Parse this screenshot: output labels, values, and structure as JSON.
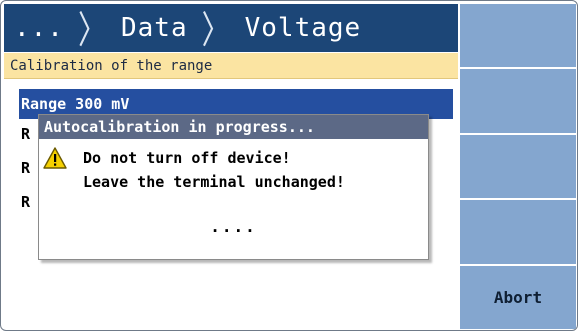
{
  "header": {
    "crumbs": [
      "...",
      "Data",
      "Voltage"
    ],
    "separator": "〉"
  },
  "subtitle": "Calibration of the range",
  "list": {
    "selected_label": "Range 300 mV",
    "stub_label": "R"
  },
  "dialog": {
    "title": "Autocalibration in progress...",
    "line1": "Do not turn off device!",
    "line2": "Leave the terminal unchanged!",
    "progress": "....",
    "icon": "warning-icon"
  },
  "softkeys": {
    "abort_label": "Abort"
  },
  "colors": {
    "titlebar": "#1c4677",
    "subtitle_bg": "#fbe4a2",
    "selection": "#254fa0",
    "softkey": "#84a6cf",
    "dialog_title": "#5c6986",
    "warning": "#f5d000"
  }
}
